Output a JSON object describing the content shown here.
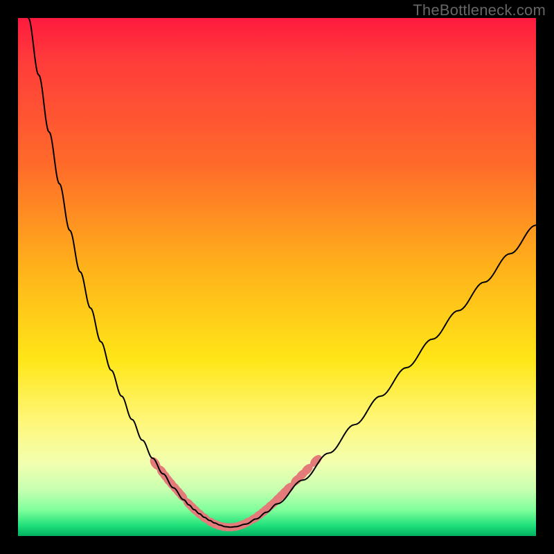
{
  "watermark": "TheBottleneck.com",
  "chart_data": {
    "type": "line",
    "title": "",
    "xlabel": "",
    "ylabel": "",
    "xlim": [
      0,
      100
    ],
    "ylim": [
      0,
      100
    ],
    "x": [
      0,
      2,
      4,
      6,
      8,
      10,
      12,
      14,
      16,
      18,
      20,
      22,
      24,
      26,
      28,
      30,
      32,
      33,
      34,
      35,
      36,
      37,
      38,
      39,
      40,
      41,
      42,
      44,
      46,
      48,
      50,
      55,
      60,
      65,
      70,
      75,
      80,
      85,
      90,
      95,
      100
    ],
    "values": [
      120,
      100,
      89,
      78,
      68,
      59,
      51,
      44,
      37.5,
      32,
      27,
      22.5,
      18.5,
      15,
      12,
      9.3,
      7,
      6,
      5.1,
      4.3,
      3.6,
      3,
      2.5,
      2.1,
      1.8,
      1.7,
      1.8,
      2.3,
      3.3,
      4.6,
      6.2,
      10.8,
      16,
      21.5,
      27,
      32.5,
      38,
      43.5,
      49,
      54.5,
      60
    ],
    "note": "V-shaped curve with minimum near x≈41 (~1.7). Left branch falls steeply from top; right branch rises roughly linearly.",
    "beads": {
      "comment": "Pink bead markers clustered near the trough of the curve, elongated along the curve direction.",
      "left_segments": [
        {
          "x": 26.5,
          "y": 14.0
        },
        {
          "x": 27.8,
          "y": 12.4
        },
        {
          "x": 28.4,
          "y": 11.6
        },
        {
          "x": 29.0,
          "y": 10.8
        },
        {
          "x": 29.6,
          "y": 10.1
        },
        {
          "x": 30.3,
          "y": 9.3
        },
        {
          "x": 31.0,
          "y": 8.5
        },
        {
          "x": 31.6,
          "y": 7.8
        },
        {
          "x": 33.0,
          "y": 6.2
        },
        {
          "x": 33.6,
          "y": 5.6
        },
        {
          "x": 34.2,
          "y": 5.0
        },
        {
          "x": 35.0,
          "y": 4.3
        },
        {
          "x": 36.0,
          "y": 3.5
        }
      ],
      "bottom_segments": [
        {
          "x": 37.2,
          "y": 2.7
        },
        {
          "x": 38.0,
          "y": 2.3
        },
        {
          "x": 38.8,
          "y": 2.0
        },
        {
          "x": 39.6,
          "y": 1.8
        },
        {
          "x": 40.4,
          "y": 1.7
        },
        {
          "x": 41.2,
          "y": 1.7
        },
        {
          "x": 42.0,
          "y": 1.8
        },
        {
          "x": 42.8,
          "y": 2.0
        },
        {
          "x": 43.6,
          "y": 2.3
        },
        {
          "x": 44.4,
          "y": 2.7
        }
      ],
      "right_segments": [
        {
          "x": 45.5,
          "y": 3.3
        },
        {
          "x": 46.5,
          "y": 4.0
        },
        {
          "x": 47.3,
          "y": 4.6
        },
        {
          "x": 48.0,
          "y": 5.2
        },
        {
          "x": 48.7,
          "y": 5.8
        },
        {
          "x": 49.4,
          "y": 6.4
        },
        {
          "x": 50.1,
          "y": 7.1
        },
        {
          "x": 50.8,
          "y": 7.8
        },
        {
          "x": 51.5,
          "y": 8.5
        },
        {
          "x": 52.2,
          "y": 9.2
        },
        {
          "x": 53.8,
          "y": 10.8
        },
        {
          "x": 54.8,
          "y": 11.8
        },
        {
          "x": 55.8,
          "y": 12.8
        },
        {
          "x": 57.5,
          "y": 14.5
        }
      ],
      "color": "#e37b7b",
      "radius_px": 6
    }
  }
}
